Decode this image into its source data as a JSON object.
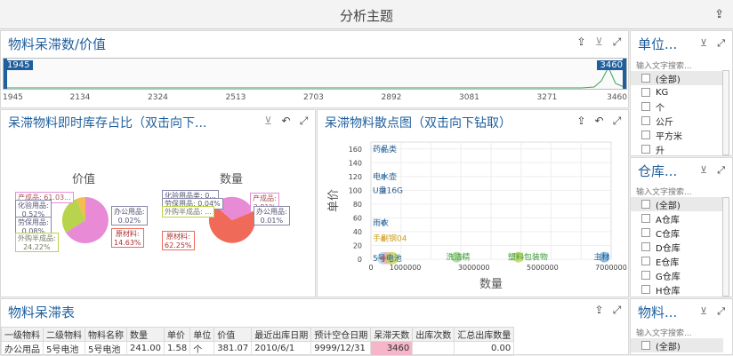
{
  "header": {
    "title": "分析主题"
  },
  "slider_panel": {
    "title": "物料呆滞数/价值",
    "range_min": "1945",
    "range_max": "3460",
    "ticks": [
      "1945",
      "2134",
      "2324",
      "2513",
      "2703",
      "2892",
      "3081",
      "3271",
      "3460"
    ]
  },
  "pie_panel": {
    "title": "呆滞物料即时库存占比（双击向下...",
    "left_title": "价值",
    "right_title": "数量",
    "left_labels": [
      "产成品: 61.03...",
      "化验用品:",
      "0.52%",
      "劳保用品:",
      "0.08%",
      "外购半成品:",
      "24.22%",
      "办公用品:",
      "0.02%",
      "原材料:",
      "14.63%"
    ],
    "right_labels": [
      "化验用品类: 0...",
      "劳保用品: 0.04%",
      "外购半成品: ...",
      "产成品:",
      "3.81%",
      "办公用品:",
      "0.01%",
      "原材料:",
      "62.25%"
    ]
  },
  "scatter_panel": {
    "title": "呆滞物料散点图（双击向下钻取）",
    "xlabel": "数量",
    "ylabel": "单价",
    "xticks": [
      "0",
      "1000000",
      "3000000",
      "5000000",
      "7000000"
    ],
    "yticks": [
      "0",
      "20",
      "40",
      "60",
      "80",
      "100",
      "120",
      "140",
      "160"
    ],
    "labels": [
      "药品类",
      "电水壶",
      "U盘16G",
      "雨衣",
      "手剧钢04",
      "5号电池",
      "洗洁精",
      "塑料包装物",
      "主材"
    ]
  },
  "chart_data": {
    "type": "scatter",
    "title": "呆滞物料散点图（双击向下钻取）",
    "xlabel": "数量",
    "ylabel": "单价",
    "xlim": [
      0,
      7000000
    ],
    "ylim": [
      0,
      170
    ],
    "points": [
      {
        "name": "药品类",
        "x": 0,
        "y": 160
      },
      {
        "name": "电水壶",
        "x": 0,
        "y": 120
      },
      {
        "name": "U盘16G",
        "x": 0,
        "y": 100
      },
      {
        "name": "雨衣",
        "x": 0,
        "y": 53
      },
      {
        "name": "手剧钢04",
        "x": 0,
        "y": 30
      },
      {
        "name": "5号电池",
        "x": 0,
        "y": 1.58
      },
      {
        "name": "洗洁精",
        "x": 2500000,
        "y": 3
      },
      {
        "name": "塑料包装物",
        "x": 4300000,
        "y": 3
      },
      {
        "name": "主材",
        "x": 6800000,
        "y": 3
      }
    ]
  },
  "filters": [
    {
      "title": "单位...",
      "search_placeholder": "输入文字搜索...",
      "items": [
        "(全部)",
        "KG",
        "个",
        "公斤",
        "平方米",
        "升"
      ]
    },
    {
      "title": "仓库...",
      "search_placeholder": "输入文字搜索...",
      "items": [
        "(全部)",
        "A仓库",
        "C仓库",
        "D仓库",
        "E仓库",
        "G仓库",
        "H仓库"
      ]
    },
    {
      "title": "物料...",
      "search_placeholder": "输入文字搜索...",
      "items": [
        "(全部)"
      ]
    }
  ],
  "table_panel": {
    "title": "物料呆滞表",
    "columns": [
      "一级物料",
      "二级物料",
      "物料名称",
      "数量",
      "单价",
      "单位",
      "价值",
      "最近出库日期",
      "预计空仓日期",
      "呆滞天数",
      "出库次数",
      "汇总出库数量"
    ],
    "rows": [
      [
        "办公用品",
        "5号电池",
        "5号电池",
        "241.00",
        "1.58",
        "个",
        "381.07",
        "2010/6/1",
        "9999/12/31",
        "3460",
        "",
        "0.00"
      ]
    ]
  },
  "colors": {
    "accent": "#1f5f9e",
    "highlight_cell": "#f4b6c8"
  }
}
